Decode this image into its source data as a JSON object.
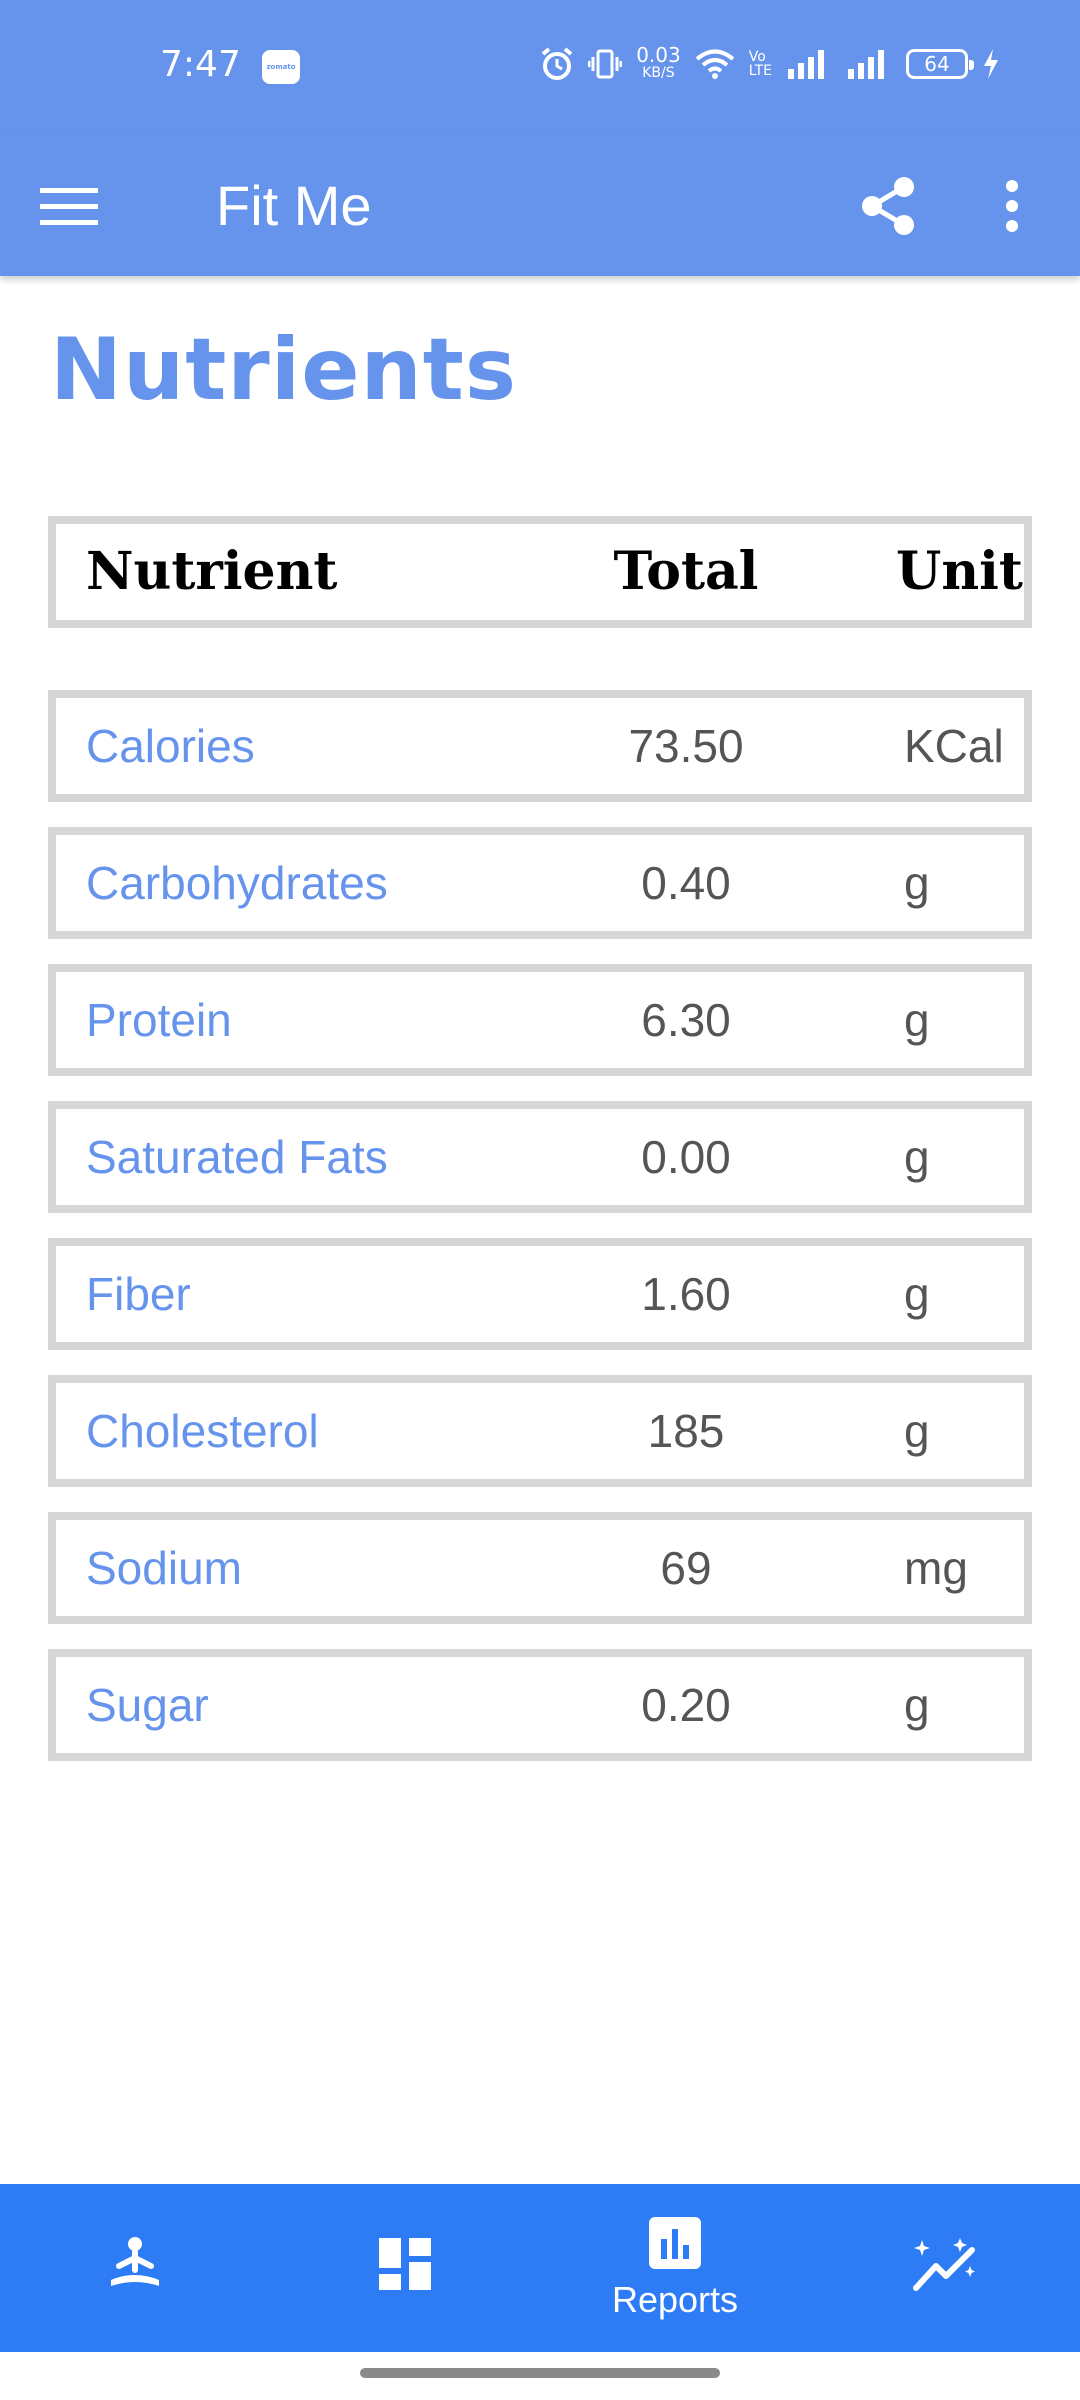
{
  "status_bar": {
    "time": "7:47",
    "notification_badge": "zomato",
    "net_speed_value": "0.03",
    "net_speed_unit": "KB/S",
    "volte_line1": "Vo",
    "volte_line2": "LTE",
    "battery_level": "64"
  },
  "app_bar": {
    "title": "Fit Me",
    "icons": [
      "menu-icon",
      "share-icon",
      "more-vert-icon"
    ]
  },
  "page": {
    "title": "Nutrients"
  },
  "table": {
    "headers": {
      "name": "Nutrient",
      "total": "Total",
      "unit": "Unit"
    },
    "rows": [
      {
        "name": "Calories",
        "total": "73.50",
        "unit": "KCal"
      },
      {
        "name": "Carbohydrates",
        "total": "0.40",
        "unit": "g"
      },
      {
        "name": "Protein",
        "total": "6.30",
        "unit": "g"
      },
      {
        "name": "Saturated Fats",
        "total": "0.00",
        "unit": "g"
      },
      {
        "name": "Fiber",
        "total": "1.60",
        "unit": "g"
      },
      {
        "name": "Cholesterol",
        "total": "185",
        "unit": "g"
      },
      {
        "name": "Sodium",
        "total": "69",
        "unit": "mg"
      },
      {
        "name": "Sugar",
        "total": "0.20",
        "unit": "g"
      }
    ]
  },
  "bottom_nav": {
    "items": [
      {
        "icon": "meditation-icon",
        "label": ""
      },
      {
        "icon": "dashboard-icon",
        "label": ""
      },
      {
        "icon": "reports-icon",
        "label": "Reports",
        "selected": true
      },
      {
        "icon": "trending-icon",
        "label": ""
      }
    ]
  },
  "colors": {
    "primary": "#6694EC",
    "bottom_nav": "#2D7CF5",
    "row_border": "#D6D6D6",
    "value_text": "#555555"
  }
}
